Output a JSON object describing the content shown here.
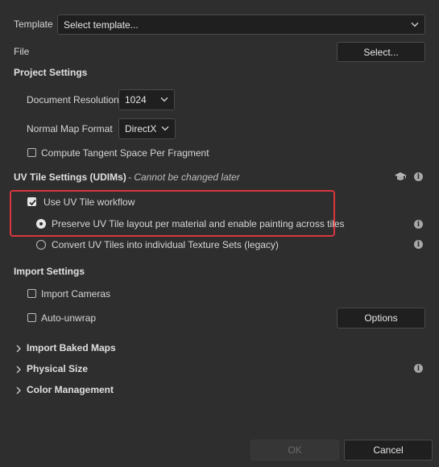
{
  "template": {
    "label": "Template",
    "value": "Select template..."
  },
  "file": {
    "label": "File",
    "button": "Select..."
  },
  "project_settings": {
    "title": "Project Settings",
    "resolution_label": "Document Resolution",
    "resolution_value": "1024",
    "normal_map_label": "Normal Map Format",
    "normal_map_value": "DirectX",
    "tangent_label": "Compute Tangent Space Per Fragment",
    "tangent_checked": false
  },
  "uv_tile": {
    "title": "UV Tile Settings (UDIMs)",
    "note": " - Cannot be changed later",
    "use_workflow_label": "Use UV Tile workflow",
    "use_workflow_checked": true,
    "preserve_label": "Preserve UV Tile layout per material and enable painting across tiles",
    "convert_label": "Convert UV Tiles into individual Texture Sets (legacy)",
    "selected": "preserve"
  },
  "import_settings": {
    "title": "Import Settings",
    "cameras_label": "Import Cameras",
    "unwrap_label": "Auto-unwrap",
    "options_button": "Options"
  },
  "collapsibles": {
    "baked_maps": "Import Baked Maps",
    "physical_size": "Physical Size",
    "color_management": "Color Management"
  },
  "footer": {
    "ok": "OK",
    "cancel": "Cancel"
  },
  "colors": {
    "highlight": "#d9363e",
    "background": "#2e2e2e"
  }
}
